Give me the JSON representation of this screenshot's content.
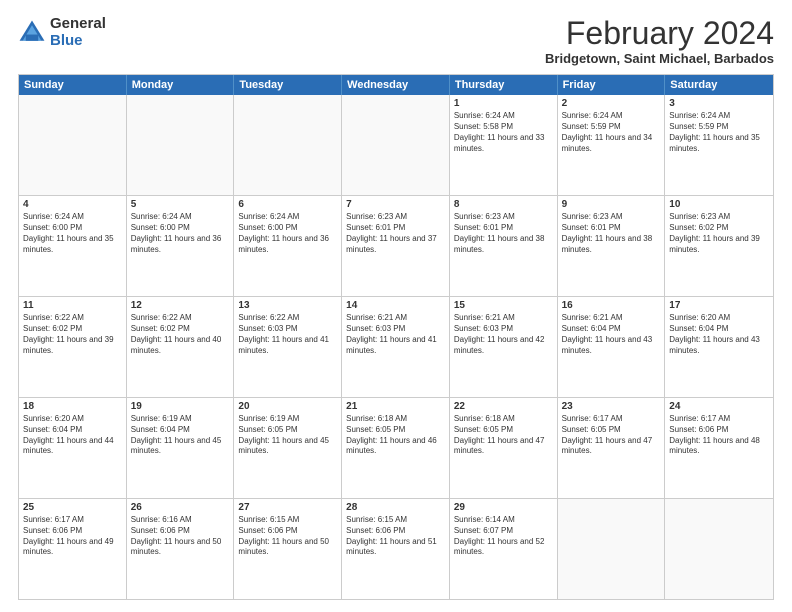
{
  "logo": {
    "general": "General",
    "blue": "Blue"
  },
  "header": {
    "title": "February 2024",
    "subtitle": "Bridgetown, Saint Michael, Barbados"
  },
  "days_of_week": [
    "Sunday",
    "Monday",
    "Tuesday",
    "Wednesday",
    "Thursday",
    "Friday",
    "Saturday"
  ],
  "weeks": [
    [
      {
        "day": "",
        "info": ""
      },
      {
        "day": "",
        "info": ""
      },
      {
        "day": "",
        "info": ""
      },
      {
        "day": "",
        "info": ""
      },
      {
        "day": "1",
        "info": "Sunrise: 6:24 AM\nSunset: 5:58 PM\nDaylight: 11 hours and 33 minutes."
      },
      {
        "day": "2",
        "info": "Sunrise: 6:24 AM\nSunset: 5:59 PM\nDaylight: 11 hours and 34 minutes."
      },
      {
        "day": "3",
        "info": "Sunrise: 6:24 AM\nSunset: 5:59 PM\nDaylight: 11 hours and 35 minutes."
      }
    ],
    [
      {
        "day": "4",
        "info": "Sunrise: 6:24 AM\nSunset: 6:00 PM\nDaylight: 11 hours and 35 minutes."
      },
      {
        "day": "5",
        "info": "Sunrise: 6:24 AM\nSunset: 6:00 PM\nDaylight: 11 hours and 36 minutes."
      },
      {
        "day": "6",
        "info": "Sunrise: 6:24 AM\nSunset: 6:00 PM\nDaylight: 11 hours and 36 minutes."
      },
      {
        "day": "7",
        "info": "Sunrise: 6:23 AM\nSunset: 6:01 PM\nDaylight: 11 hours and 37 minutes."
      },
      {
        "day": "8",
        "info": "Sunrise: 6:23 AM\nSunset: 6:01 PM\nDaylight: 11 hours and 38 minutes."
      },
      {
        "day": "9",
        "info": "Sunrise: 6:23 AM\nSunset: 6:01 PM\nDaylight: 11 hours and 38 minutes."
      },
      {
        "day": "10",
        "info": "Sunrise: 6:23 AM\nSunset: 6:02 PM\nDaylight: 11 hours and 39 minutes."
      }
    ],
    [
      {
        "day": "11",
        "info": "Sunrise: 6:22 AM\nSunset: 6:02 PM\nDaylight: 11 hours and 39 minutes."
      },
      {
        "day": "12",
        "info": "Sunrise: 6:22 AM\nSunset: 6:02 PM\nDaylight: 11 hours and 40 minutes."
      },
      {
        "day": "13",
        "info": "Sunrise: 6:22 AM\nSunset: 6:03 PM\nDaylight: 11 hours and 41 minutes."
      },
      {
        "day": "14",
        "info": "Sunrise: 6:21 AM\nSunset: 6:03 PM\nDaylight: 11 hours and 41 minutes."
      },
      {
        "day": "15",
        "info": "Sunrise: 6:21 AM\nSunset: 6:03 PM\nDaylight: 11 hours and 42 minutes."
      },
      {
        "day": "16",
        "info": "Sunrise: 6:21 AM\nSunset: 6:04 PM\nDaylight: 11 hours and 43 minutes."
      },
      {
        "day": "17",
        "info": "Sunrise: 6:20 AM\nSunset: 6:04 PM\nDaylight: 11 hours and 43 minutes."
      }
    ],
    [
      {
        "day": "18",
        "info": "Sunrise: 6:20 AM\nSunset: 6:04 PM\nDaylight: 11 hours and 44 minutes."
      },
      {
        "day": "19",
        "info": "Sunrise: 6:19 AM\nSunset: 6:04 PM\nDaylight: 11 hours and 45 minutes."
      },
      {
        "day": "20",
        "info": "Sunrise: 6:19 AM\nSunset: 6:05 PM\nDaylight: 11 hours and 45 minutes."
      },
      {
        "day": "21",
        "info": "Sunrise: 6:18 AM\nSunset: 6:05 PM\nDaylight: 11 hours and 46 minutes."
      },
      {
        "day": "22",
        "info": "Sunrise: 6:18 AM\nSunset: 6:05 PM\nDaylight: 11 hours and 47 minutes."
      },
      {
        "day": "23",
        "info": "Sunrise: 6:17 AM\nSunset: 6:05 PM\nDaylight: 11 hours and 47 minutes."
      },
      {
        "day": "24",
        "info": "Sunrise: 6:17 AM\nSunset: 6:06 PM\nDaylight: 11 hours and 48 minutes."
      }
    ],
    [
      {
        "day": "25",
        "info": "Sunrise: 6:17 AM\nSunset: 6:06 PM\nDaylight: 11 hours and 49 minutes."
      },
      {
        "day": "26",
        "info": "Sunrise: 6:16 AM\nSunset: 6:06 PM\nDaylight: 11 hours and 50 minutes."
      },
      {
        "day": "27",
        "info": "Sunrise: 6:15 AM\nSunset: 6:06 PM\nDaylight: 11 hours and 50 minutes."
      },
      {
        "day": "28",
        "info": "Sunrise: 6:15 AM\nSunset: 6:06 PM\nDaylight: 11 hours and 51 minutes."
      },
      {
        "day": "29",
        "info": "Sunrise: 6:14 AM\nSunset: 6:07 PM\nDaylight: 11 hours and 52 minutes."
      },
      {
        "day": "",
        "info": ""
      },
      {
        "day": "",
        "info": ""
      }
    ]
  ]
}
